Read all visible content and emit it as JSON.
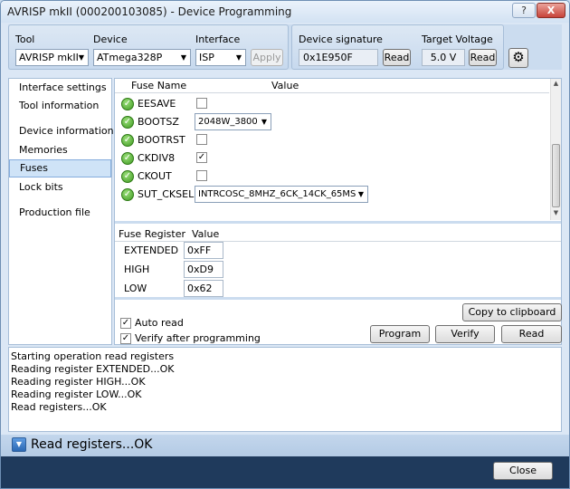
{
  "window": {
    "title": "AVRISP mkII (000200103085) - Device Programming",
    "help": "?",
    "close": "X"
  },
  "toolbar": {
    "tool_label": "Tool",
    "tool_value": "AVRISP mkII",
    "device_label": "Device",
    "device_value": "ATmega328P",
    "interface_label": "Interface",
    "interface_value": "ISP",
    "apply": "Apply",
    "signature_label": "Device signature",
    "signature_value": "0x1E950F",
    "signature_read": "Read",
    "voltage_label": "Target Voltage",
    "voltage_value": "5.0 V",
    "voltage_read": "Read",
    "gear": "⚙"
  },
  "sidebar": {
    "items": [
      {
        "label": "Interface settings"
      },
      {
        "label": "Tool information"
      },
      {
        "label": "Device information"
      },
      {
        "label": "Memories"
      },
      {
        "label": "Fuses"
      },
      {
        "label": "Lock bits"
      },
      {
        "label": "Production file"
      }
    ],
    "selected": "Fuses"
  },
  "fuses": {
    "col_name": "Fuse Name",
    "col_value": "Value",
    "rows": [
      {
        "name": "EESAVE",
        "checked": ""
      },
      {
        "name": "BOOTSZ",
        "value": "2048W_3800"
      },
      {
        "name": "BOOTRST",
        "checked": ""
      },
      {
        "name": "CKDIV8",
        "checked": "✓"
      },
      {
        "name": "CKOUT",
        "checked": ""
      },
      {
        "name": "SUT_CKSEL",
        "value": "INTRCOSC_8MHZ_6CK_14CK_65MS"
      }
    ]
  },
  "registers": {
    "col_name": "Fuse Register",
    "col_value": "Value",
    "rows": [
      {
        "name": "EXTENDED",
        "value": "0xFF"
      },
      {
        "name": "HIGH",
        "value": "0xD9"
      },
      {
        "name": "LOW",
        "value": "0x62"
      }
    ]
  },
  "actions": {
    "copy": "Copy to clipboard",
    "auto_read": "Auto read",
    "auto_read_checked": "✓",
    "verify_after": "Verify after programming",
    "verify_after_checked": "✓",
    "program": "Program",
    "verify": "Verify",
    "read": "Read"
  },
  "log": {
    "lines": [
      "Starting operation read registers",
      "Reading register EXTENDED...OK",
      "Reading register HIGH...OK",
      "Reading register LOW...OK",
      "Read registers...OK"
    ]
  },
  "status": {
    "text": "Read registers...OK",
    "toggle": "▼"
  },
  "footer": {
    "close": "Close"
  }
}
